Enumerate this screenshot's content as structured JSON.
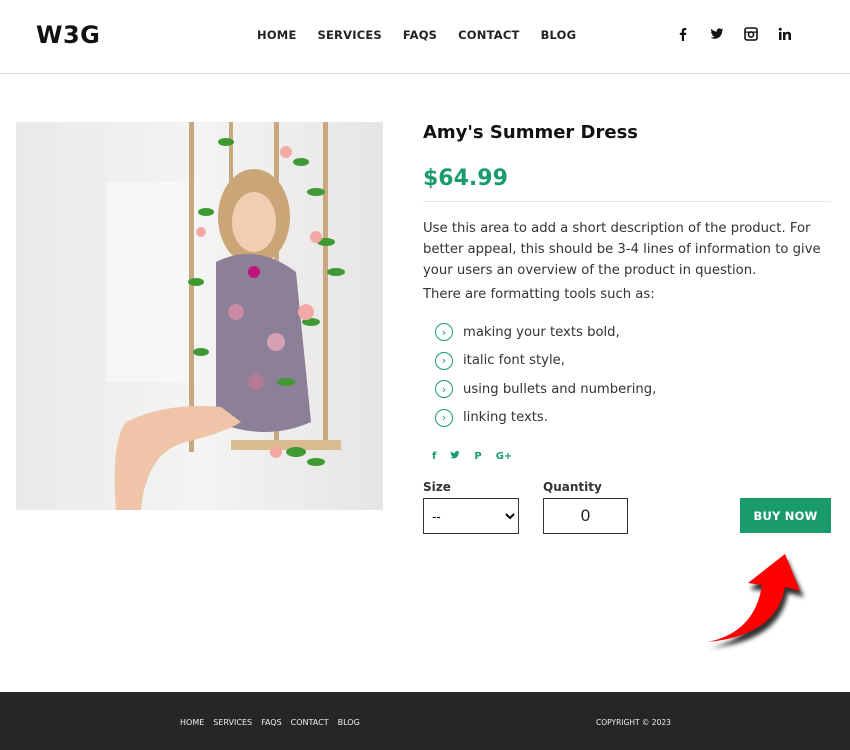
{
  "header": {
    "logo": "W3G",
    "nav": [
      {
        "label": "HOME"
      },
      {
        "label": "SERVICES"
      },
      {
        "label": "FAQS"
      },
      {
        "label": "CONTACT"
      },
      {
        "label": "BLOG"
      }
    ],
    "social": [
      {
        "icon": "facebook-icon",
        "glyph": "f"
      },
      {
        "icon": "twitter-icon",
        "glyph": "🐦"
      },
      {
        "icon": "instagram-icon",
        "glyph": "◙"
      },
      {
        "icon": "linkedin-icon",
        "glyph": "in"
      }
    ]
  },
  "product": {
    "image_alt": "Woman in floral dress sitting on a rope swing decorated with leaves and roses",
    "title": "Amy's Summer Dress",
    "price": "$64.99",
    "description": "Use this area to add a short description of the product. For better appeal, this should be 3-4 lines of information to give your users an overview of the product in question.",
    "formatting_intro": "There are formatting tools such as:",
    "features": [
      {
        "text": "making your texts bold,"
      },
      {
        "text": "italic font style,"
      },
      {
        "text": "using bullets and numbering,"
      },
      {
        "text": "linking texts."
      }
    ],
    "share": [
      {
        "icon": "facebook-share-icon",
        "glyph": "f"
      },
      {
        "icon": "twitter-share-icon",
        "glyph": "🐦"
      },
      {
        "icon": "pinterest-share-icon",
        "glyph": "P"
      },
      {
        "icon": "google-plus-share-icon",
        "glyph": "G+"
      }
    ],
    "size_label": "Size",
    "size_value": "--",
    "quantity_label": "Quantity",
    "quantity_value": "0",
    "buy_label": "BUY NOW"
  },
  "annotation": {
    "icon": "red-arrow-icon",
    "color": "#ff0000"
  },
  "footer": {
    "nav": [
      {
        "label": "HOME"
      },
      {
        "label": "SERVICES"
      },
      {
        "label": "FAQS"
      },
      {
        "label": "CONTACT"
      },
      {
        "label": "BLOG"
      }
    ],
    "copyright": "COPYRIGHT © 2023"
  },
  "colors": {
    "accent": "#1a9b6c",
    "footer_bg": "#262626"
  }
}
